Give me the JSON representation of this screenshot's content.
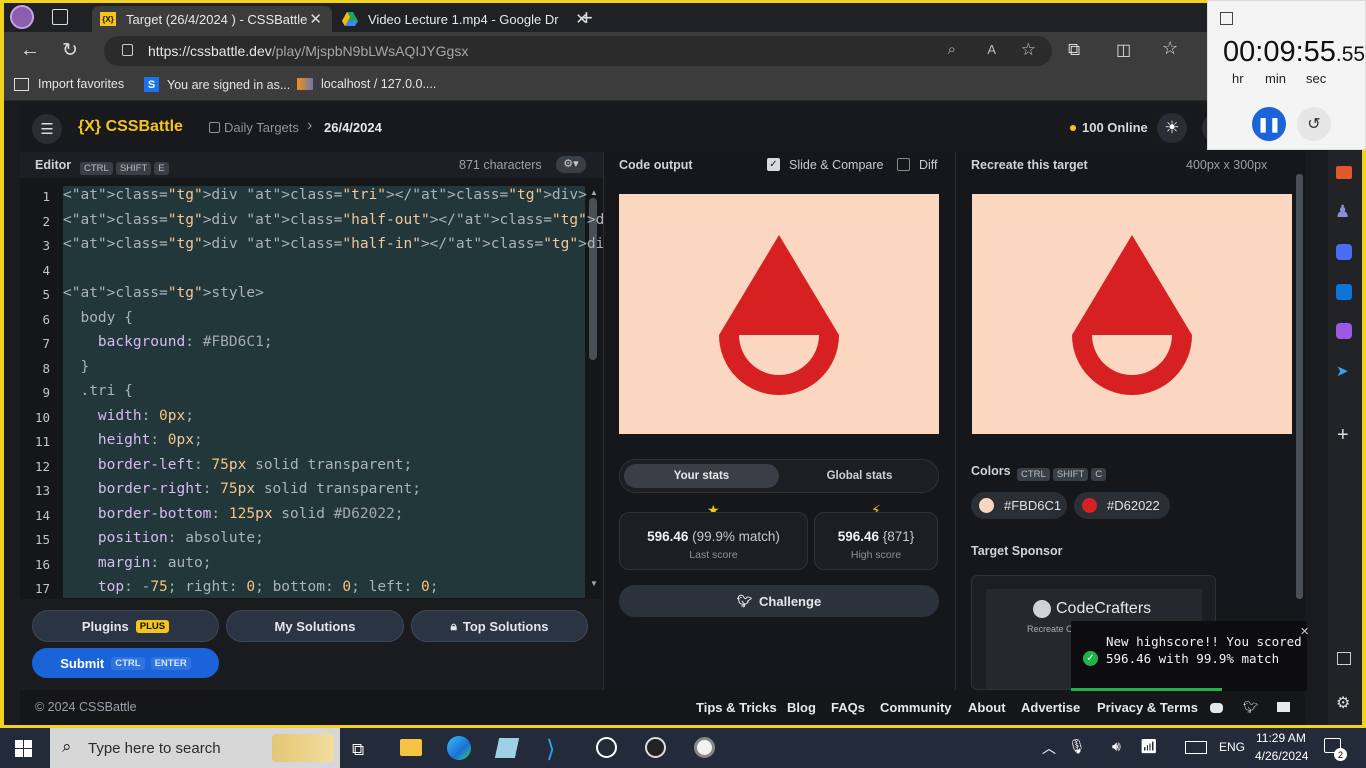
{
  "browser": {
    "tabs": [
      {
        "label": "Target (26/4/2024 ) - CSSBattle"
      },
      {
        "label": "Video Lecture 1.mp4 - Google Dr"
      }
    ],
    "url_host": "https://cssbattle.dev",
    "url_path": "/play/MjspbN9bLWsAQIJYGgsx",
    "favorites": [
      "Import favorites",
      "You are signed in as...",
      "localhost / 127.0.0...."
    ]
  },
  "timer": {
    "hours": "00",
    "minutes": "09",
    "seconds": "55",
    "fraction": ".55",
    "labels": [
      "hr",
      "min",
      "sec"
    ]
  },
  "app": {
    "logo": "{X} CSSBattle",
    "breadcrumb": [
      "Daily Targets",
      "26/4/2024"
    ],
    "online": "100 Online"
  },
  "editor": {
    "title": "Editor",
    "shortcut": [
      "CTRL",
      "SHIFT",
      "E"
    ],
    "chars": "871 characters",
    "line_numbers": [
      "1",
      "2",
      "3",
      "4",
      "5",
      "6",
      "7",
      "8",
      "9",
      "10",
      "11",
      "12",
      "13",
      "14",
      "15",
      "16",
      "17"
    ],
    "lines": [
      "<div class=\"tri\"></div>",
      "<div class=\"half-out\"></div>",
      "<div class=\"half-in\"></div>",
      "",
      "<style>",
      "  body {",
      "    background: #FBD6C1;",
      "  }",
      "  .tri {",
      "    width: 0px;",
      "    height: 0px;",
      "    border-left: 75px solid transparent;",
      "    border-right: 75px solid transparent;",
      "    border-bottom: 125px solid #D62022;",
      "    position: absolute;",
      "    margin: auto;",
      "    top: -75; right: 0; bottom: 0; left: 0;"
    ],
    "buttons": {
      "plugins": "Plugins",
      "plus": "PLUS",
      "my_solutions": "My Solutions",
      "top_solutions": "Top Solutions",
      "submit": "Submit",
      "submit_keys": [
        "CTRL",
        "ENTER"
      ]
    }
  },
  "output": {
    "title": "Code output",
    "slide_compare": "Slide & Compare",
    "diff": "Diff",
    "tabs": [
      "Your stats",
      "Global stats"
    ],
    "last_score": "596.46",
    "last_match": "(99.9% match)",
    "last_label": "Last score",
    "high_score": "596.46",
    "high_chars": "{871}",
    "high_label": "High score",
    "challenge": "Challenge"
  },
  "target": {
    "title": "Recreate this target",
    "size": "400px x 300px",
    "colors_label": "Colors",
    "colors_keys": [
      "CTRL",
      "SHIFT",
      "C"
    ],
    "colors": [
      {
        "hex": "#FBD6C1",
        "swatch": "#FBD6C1"
      },
      {
        "hex": "#D62022",
        "swatch": "#D62022"
      }
    ],
    "sponsor_label": "Target Sponsor",
    "sponsor_name": "CodeCrafters",
    "sponsor_sub": "Recreate Cor"
  },
  "toast": {
    "message": "New highscore!! You scored 596.46 with 99.9% match"
  },
  "footer": {
    "copyright": "© 2024 CSSBattle",
    "links": [
      "Tips & Tricks",
      "Blog",
      "FAQs",
      "Community",
      "About",
      "Advertise",
      "Privacy & Terms"
    ]
  },
  "taskbar": {
    "search": "Type here to search",
    "time": "11:29 AM",
    "date": "4/26/2024",
    "lang": "ENG",
    "notif": "2"
  },
  "colors": {
    "bg": "#FBD6C1",
    "accent": "#D62022",
    "brand": "#F5C518",
    "submit": "#1a63d8"
  }
}
